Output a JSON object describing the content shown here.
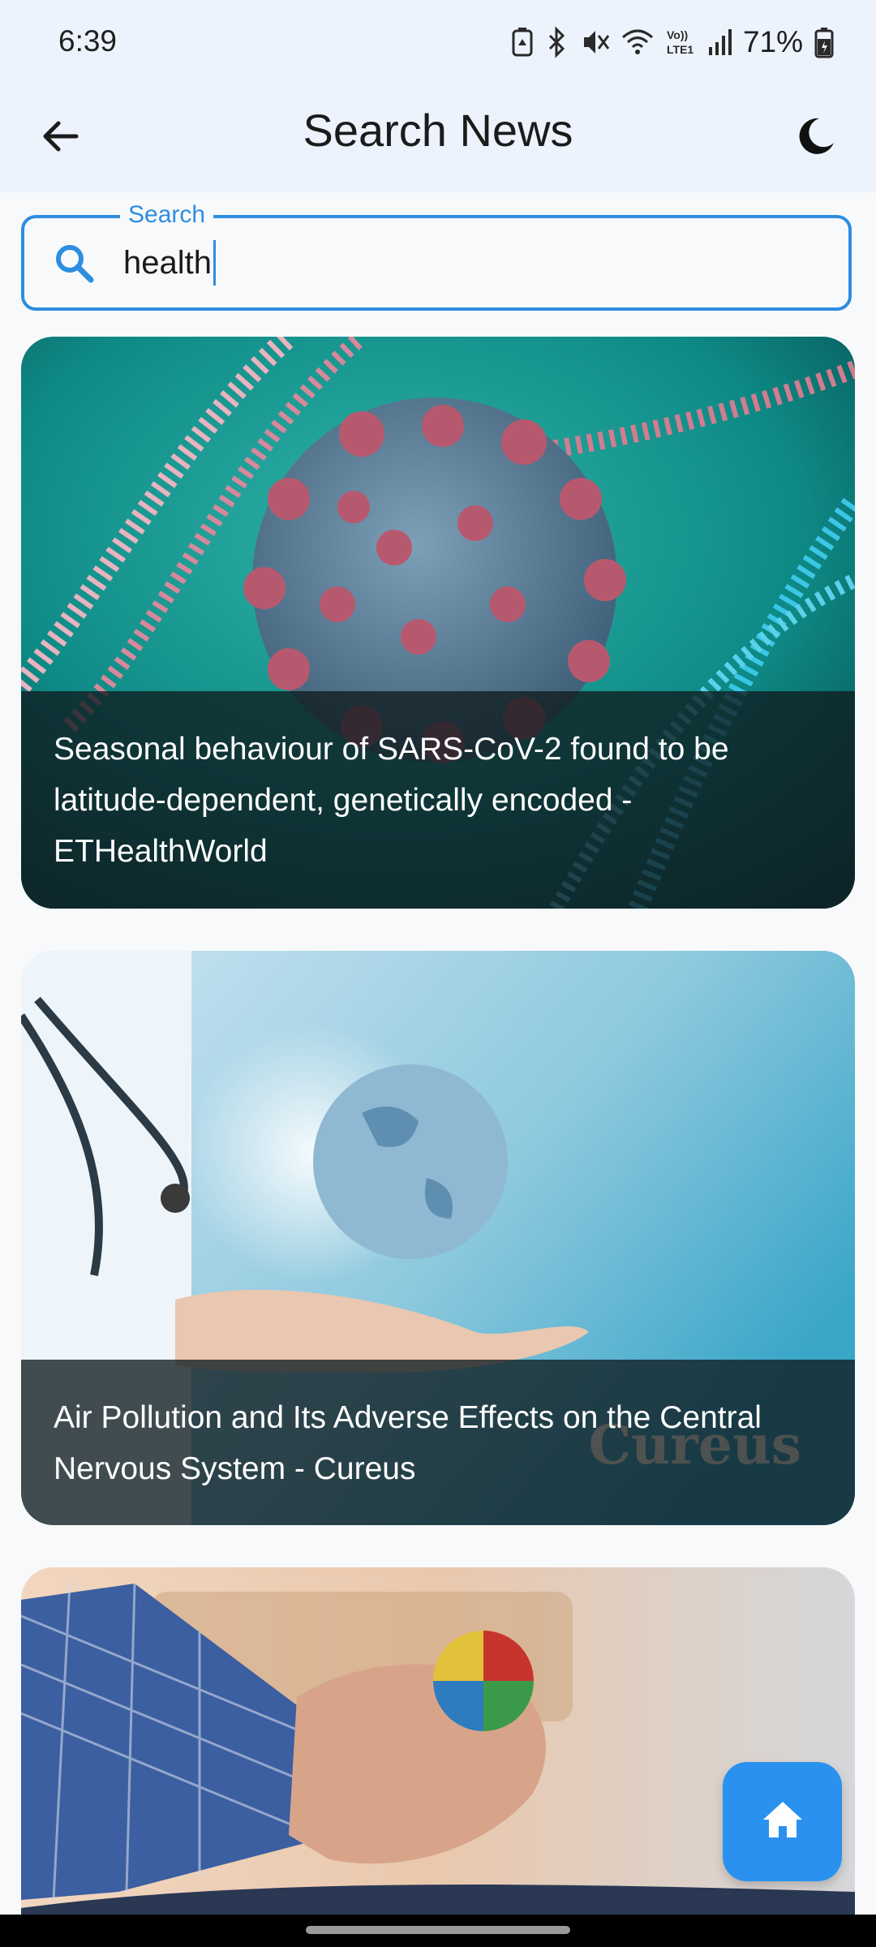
{
  "status_bar": {
    "time": "6:39",
    "battery": "71%",
    "icons": [
      "nfc-icon",
      "bluetooth-icon",
      "mute-icon",
      "wifi-icon",
      "volte-icon",
      "signal-icon",
      "battery-icon"
    ],
    "volte_text": "Vo))\nLTE1"
  },
  "app_bar": {
    "title": "Search News",
    "back_icon": "arrow-left-icon",
    "theme_icon": "moon-icon"
  },
  "search": {
    "label": "Search",
    "value": "health",
    "icon": "search-icon",
    "accent": "#2d8ee0"
  },
  "articles": [
    {
      "title": "Seasonal behaviour of SARS-CoV-2 found to be latitude-dependent, genetically encoded - ETHealthWorld"
    },
    {
      "title": "Air Pollution and Its Adverse Effects on the Central Nervous System - Cureus",
      "watermark": "Cureus"
    },
    {
      "title": ""
    }
  ],
  "fab": {
    "icon": "home-icon",
    "color": "#2a92ee"
  }
}
